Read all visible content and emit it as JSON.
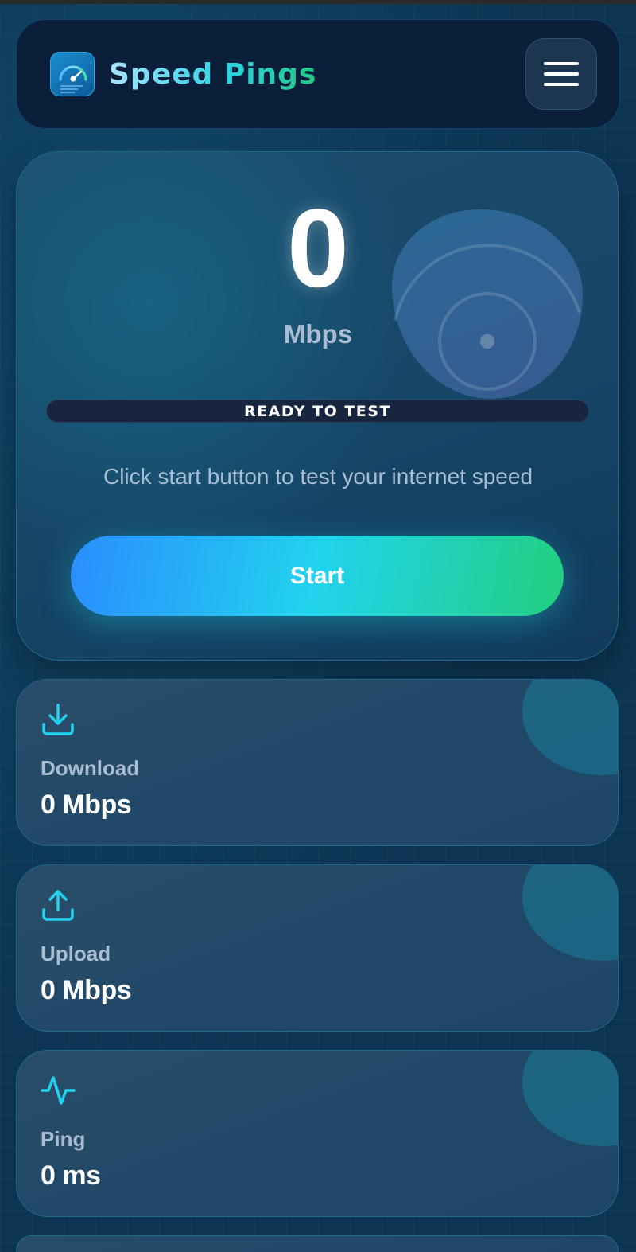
{
  "header": {
    "brand": "Speed Pings",
    "logo_icon": "speedometer-icon",
    "menu_icon": "hamburger-menu-icon"
  },
  "test": {
    "speed_value": "0",
    "speed_unit": "Mbps",
    "progress_percent": 0,
    "status": "READY TO TEST",
    "hint": "Click start button to test your internet speed",
    "start_label": "Start"
  },
  "stats": [
    {
      "icon": "download-icon",
      "label": "Download",
      "value": "0 Mbps"
    },
    {
      "icon": "upload-icon",
      "label": "Upload",
      "value": "0 Mbps"
    },
    {
      "icon": "activity-icon",
      "label": "Ping",
      "value": "0 ms"
    }
  ],
  "colors": {
    "accent": "#22d3ee",
    "accent_blue": "#2a8dff",
    "accent_green": "#22cf7e",
    "background": "#0c3552"
  }
}
